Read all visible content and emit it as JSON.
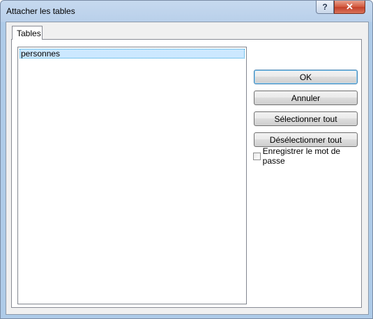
{
  "window": {
    "title": "Attacher les tables",
    "help_label": "?",
    "close_label": "✕"
  },
  "tabs": [
    {
      "label": "Tables"
    }
  ],
  "list": {
    "items": [
      "personnes"
    ]
  },
  "buttons": {
    "ok": "OK",
    "cancel": "Annuler",
    "select_all": "Sélectionner tout",
    "deselect_all": "Désélectionner tout"
  },
  "options": {
    "save_password": {
      "label": "Enregistrer le mot de passe",
      "checked": false
    }
  }
}
